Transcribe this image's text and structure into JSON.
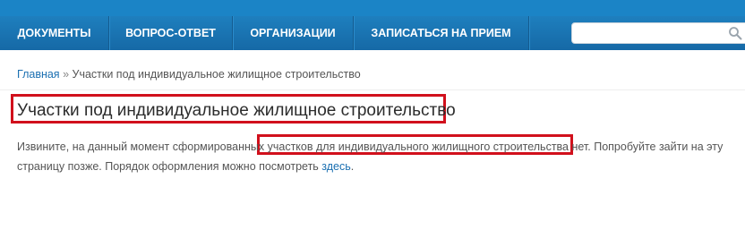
{
  "nav": {
    "items": [
      {
        "label": "ДОКУМЕНТЫ"
      },
      {
        "label": "ВОПРОС-ОТВЕТ"
      },
      {
        "label": "ОРГАНИЗАЦИИ"
      },
      {
        "label": "ЗАПИСАТЬСЯ НА ПРИЕМ"
      }
    ]
  },
  "search": {
    "value": "",
    "placeholder": "",
    "icon": "search-icon"
  },
  "breadcrumb": {
    "home": "Главная",
    "separator": "»",
    "current": "Участки под индивидуальное жилищное строительство"
  },
  "page": {
    "title": "Участки под индивидуальное жилищное строительство",
    "message_part1": "Извините, на данный момент сформированных ",
    "message_highlight": "участков для индивидуального жилищного строительства нет",
    "message_part2": ". Попробуйте зайти на эту страницу позже. Порядок оформления можно посмотреть ",
    "message_link": "здесь",
    "message_end": "."
  },
  "colors": {
    "nav_background": "#1b74b5",
    "highlight_border": "#d1101c",
    "link": "#1a6fb1"
  }
}
